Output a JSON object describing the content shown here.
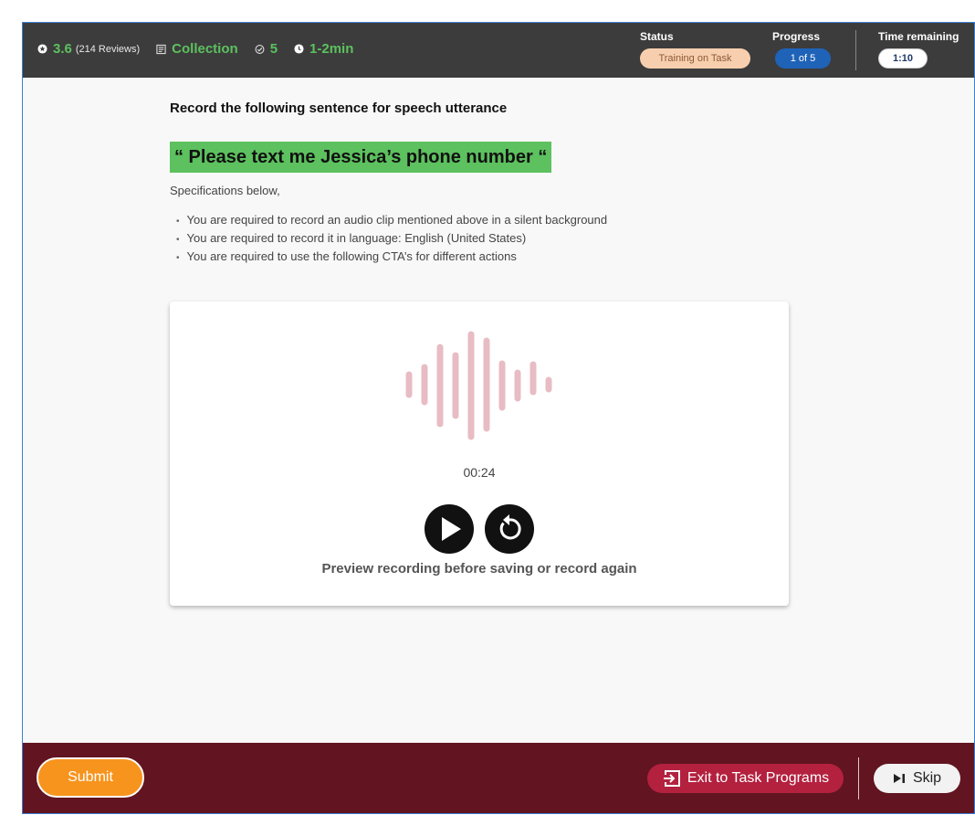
{
  "header": {
    "rating": "3.6",
    "reviews": "(214 Reviews)",
    "category": "Collection",
    "task_count": "5",
    "duration": "1-2min",
    "status_label": "Status",
    "status_value": "Training on Task",
    "progress_label": "Progress",
    "progress_value": "1 of 5",
    "time_label": "Time remaining",
    "time_value": "1:10"
  },
  "task": {
    "instruction": "Record the following sentence for speech utterance",
    "sentence": "“ Please text me Jessica’s phone number “",
    "spec_intro": "Specifications below,",
    "specs": [
      "You are required to record an audio clip mentioned above in a silent background",
      "You are required to record it in language: English (United States)",
      "You are required to use the following CTA’s for different actions"
    ]
  },
  "recorder": {
    "elapsed": "00:24",
    "preview_hint": "Preview recording before saving or record again",
    "waveform_color": "#e8bcc4"
  },
  "footer": {
    "submit_label": "Submit",
    "exit_label": "Exit to Task Programs",
    "skip_label": "Skip"
  },
  "colors": {
    "accent_green": "#5cc15e",
    "footer_bg": "#621421",
    "submit_orange": "#f7941d",
    "exit_red": "#b3213f",
    "progress_blue": "#1f63b8"
  }
}
